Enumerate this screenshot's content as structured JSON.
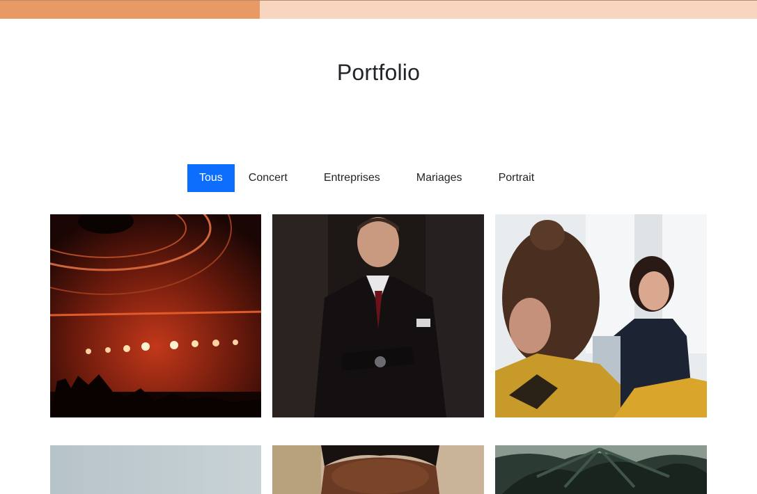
{
  "progress": {
    "fraction": 0.343
  },
  "page": {
    "title": "Portfolio"
  },
  "filters": [
    {
      "label": "Tous",
      "active": true
    },
    {
      "label": "Concert",
      "active": false
    },
    {
      "label": "Entreprises",
      "active": false
    },
    {
      "label": "Mariages",
      "active": false
    },
    {
      "label": "Portrait",
      "active": false
    }
  ],
  "colors": {
    "accent": "#0d6efd",
    "progress_fill": "#e99a64",
    "progress_track": "#f8d5bf"
  },
  "gallery": [
    {
      "subject": "concert-stage-photo"
    },
    {
      "subject": "businessman-portrait-photo"
    },
    {
      "subject": "office-meeting-photo"
    },
    {
      "subject": "sky-photo"
    },
    {
      "subject": "face-portrait-photo"
    },
    {
      "subject": "palm-tree-photo"
    }
  ]
}
